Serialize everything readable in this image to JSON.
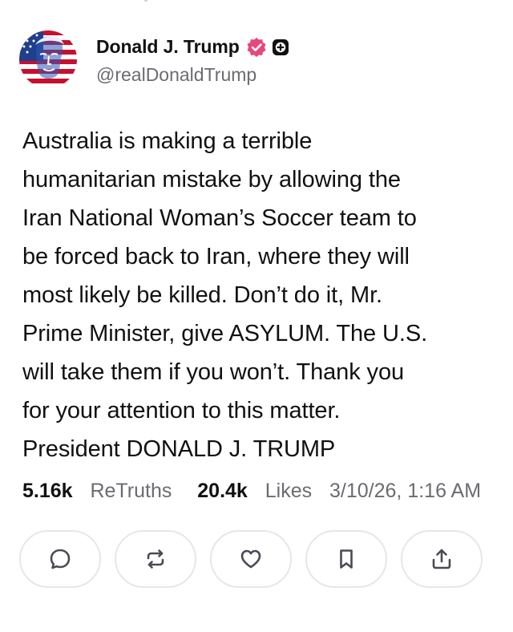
{
  "author": {
    "display_name": "Donald J. Trump",
    "handle": "@realDonaldTrump",
    "avatar_icon": "flag-portrait-avatar",
    "verified_icon": "verified-badge-icon",
    "extra_badge_icon": "plus-badge-icon",
    "verified_color": "#e6477f"
  },
  "post": {
    "lines": [
      "Australia is making a terrible",
      "humanitarian mistake by allowing the",
      "Iran National Woman’s Soccer team to",
      "be forced back to Iran, where they will",
      "most likely be killed. Don’t do it, Mr.",
      "Prime Minister, give ASYLUM. The U.S.",
      "will take them if you won’t. Thank you",
      "for your attention to this matter.",
      "President DONALD J. TRUMP"
    ]
  },
  "stats": {
    "retruths_count": "5.16k",
    "retruths_label": "ReTruths",
    "likes_count": "20.4k",
    "likes_label": "Likes",
    "timestamp": "3/10/26, 1:16 AM"
  },
  "actions": [
    {
      "name": "reply",
      "icon": "comment-icon"
    },
    {
      "name": "retruth",
      "icon": "repost-icon"
    },
    {
      "name": "like",
      "icon": "heart-icon"
    },
    {
      "name": "bookmark",
      "icon": "bookmark-icon"
    },
    {
      "name": "share",
      "icon": "share-icon"
    }
  ]
}
